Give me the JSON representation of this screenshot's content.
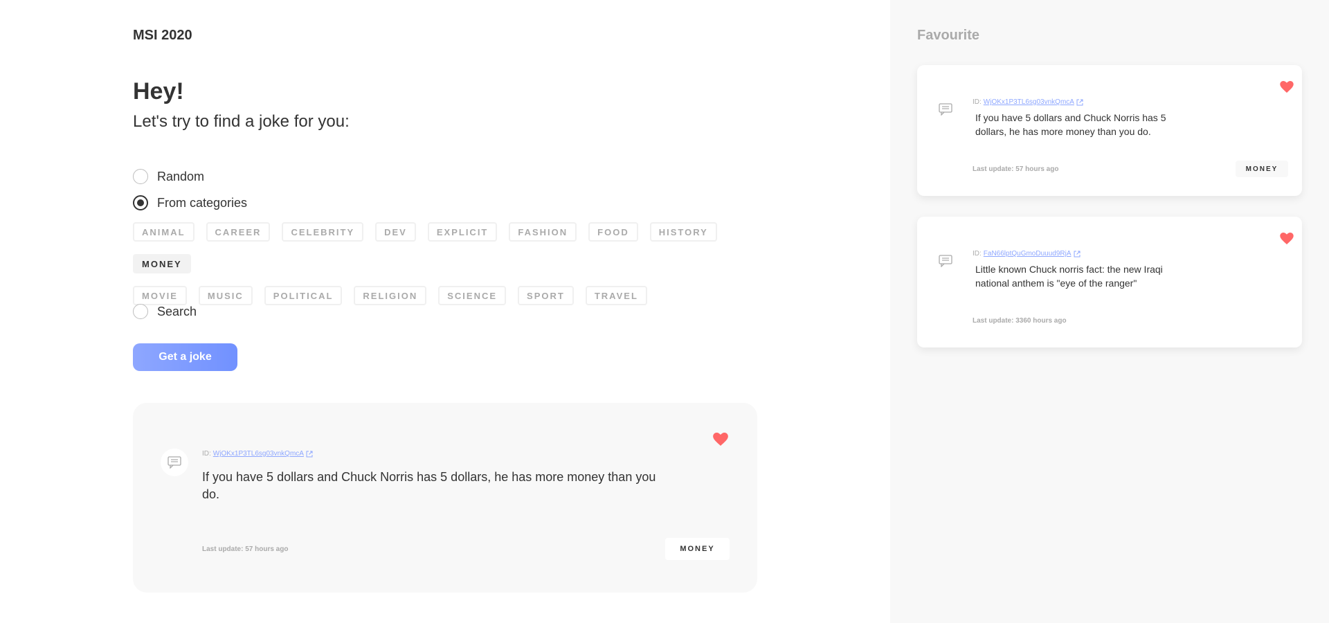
{
  "header": {
    "brand": "MSI 2020"
  },
  "main": {
    "greeting": "Hey!",
    "subtitle": "Let's try to find a joke for you:",
    "options": [
      {
        "label": "Random",
        "checked": false
      },
      {
        "label": "From categories",
        "checked": true
      },
      {
        "label": "Search",
        "checked": false
      }
    ],
    "categories": [
      "ANIMAL",
      "CAREER",
      "CELEBRITY",
      "DEV",
      "EXPLICIT",
      "FASHION",
      "FOOD",
      "HISTORY",
      "MONEY",
      "MOVIE",
      "MUSIC",
      "POLITICAL",
      "RELIGION",
      "SCIENCE",
      "SPORT",
      "TRAVEL"
    ],
    "selected_category": "MONEY",
    "get_button": "Get a joke",
    "joke": {
      "id_label": "ID:",
      "id": "WjOKx1P3TL6sg03vnkQmcA",
      "text": "If you have 5 dollars and Chuck Norris has 5 dollars, he has more money than you do.",
      "last_update": "Last update: 57 hours ago",
      "category": "MONEY",
      "favourite": true
    }
  },
  "sidebar": {
    "title": "Favourite",
    "favourites": [
      {
        "id_label": "ID:",
        "id": "WjOKx1P3TL6sg03vnkQmcA",
        "text": "If you have 5 dollars and Chuck Norris has 5 dollars, he has more money than you do.",
        "last_update": "Last update: 57 hours ago",
        "category": "MONEY"
      },
      {
        "id_label": "ID:",
        "id": "FaN66lptQuGmoDuuud9RjA",
        "text": "Little known Chuck norris fact: the new Iraqi national anthem is \"eye of the ranger\"",
        "last_update": "Last update: 3360 hours ago",
        "category": ""
      }
    ]
  },
  "colors": {
    "accent": "#7191ff",
    "heart": "#ff6767",
    "sidebar_bg": "#f8f8f8",
    "card_bg": "#f8f8f8",
    "text": "#333333",
    "muted": "#aaaaaa"
  },
  "icons": {
    "chat": "chat-bubble-icon",
    "heart": "heart-icon",
    "external": "external-link-icon"
  }
}
